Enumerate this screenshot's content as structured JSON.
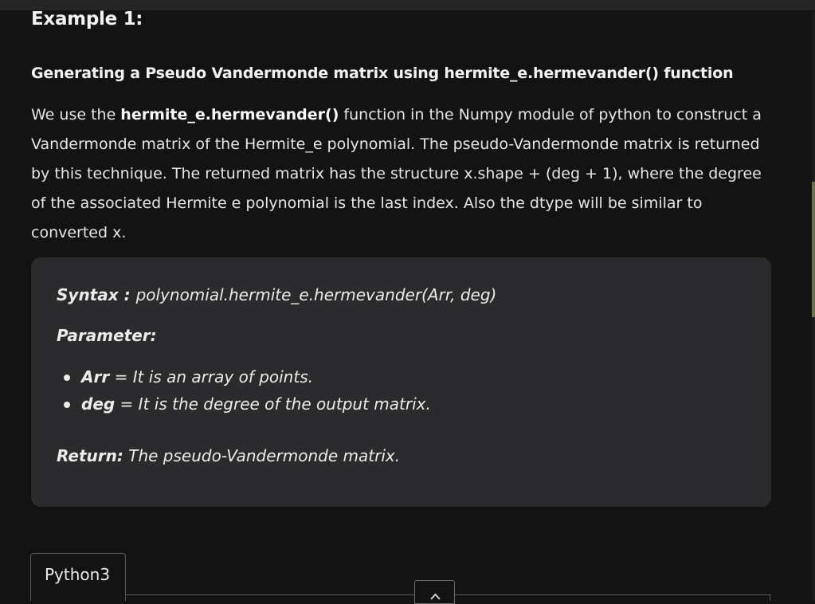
{
  "article": {
    "example_heading": "Example 1:",
    "sub_heading": "Generating a Pseudo Vandermonde matrix using hermite_e.hermevander() function",
    "paragraph": {
      "intro": "We use the ",
      "function_name": "hermite_e.hermevander()",
      "rest": " function in the Numpy module of python to construct a Vandermonde matrix of the Hermite_e polynomial. The pseudo-Vandermonde matrix is returned by this technique. The returned matrix has the structure x.shape + (deg + 1), where the degree of the associated Hermite e polynomial is the last index. Also the dtype will be similar to converted x."
    }
  },
  "syntax_box": {
    "syntax_label": "Syntax : ",
    "syntax_value": "polynomial.hermite_e.hermevander(Arr, deg)",
    "parameter_label": "Parameter:",
    "params": [
      {
        "name": "Arr",
        "desc": " = It is an array of points."
      },
      {
        "name": "deg",
        "desc": " = It is the degree of the output matrix."
      }
    ],
    "return_label": "Return:",
    "return_value": " The pseudo-Vandermonde matrix."
  },
  "code_tabs": {
    "active_tab": "Python3"
  },
  "icons": {
    "scroll_top": "chevron-up-icon"
  },
  "colors": {
    "background": "#131313",
    "syntax_box_bg": "#2b2b2d",
    "text": "#ececec"
  }
}
